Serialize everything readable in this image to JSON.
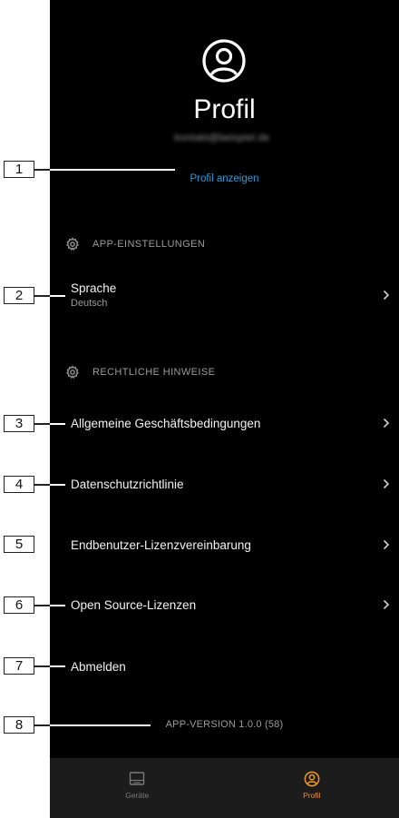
{
  "header": {
    "title": "Profil",
    "email": "kontakt@beispiel.de",
    "show_profile": "Profil anzeigen"
  },
  "sections": {
    "app_settings": "APP-EINSTELLUNGEN",
    "legal": "RECHTLICHE HINWEISE"
  },
  "language": {
    "label": "Sprache",
    "value": "Deutsch"
  },
  "legal_items": [
    "Allgemeine Geschäftsbedingungen",
    "Datenschutzrichtlinie",
    "Endbenutzer-Lizenzvereinbarung",
    "Open Source-Lizenzen"
  ],
  "logout": "Abmelden",
  "version": "APP-VERSION 1.0.0 (58)",
  "bottom_nav": {
    "devices": "Geräte",
    "profile": "Profil"
  },
  "callouts": [
    "1",
    "2",
    "3",
    "4",
    "5",
    "6",
    "7",
    "8"
  ],
  "colors": {
    "background": "#000000",
    "link": "#2a9bd8",
    "active_tab": "#e8932a",
    "nav_bar": "#1c1c1c"
  },
  "icons": {
    "profile": "user-circle-icon",
    "settings": "gear-icon",
    "chevron": "chevron-right-icon",
    "devices": "device-icon"
  }
}
